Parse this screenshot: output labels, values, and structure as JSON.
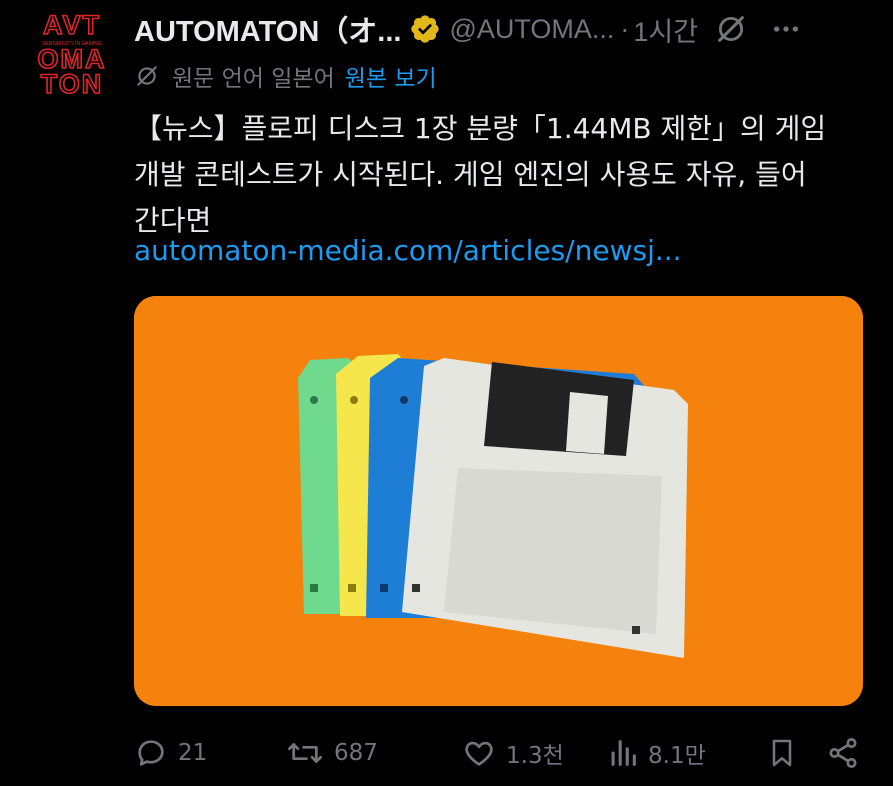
{
  "author": {
    "avatar_text": [
      "AVT",
      "OMA",
      "TON"
    ],
    "avatar_tagline": "VERSATILITY IN GAMING",
    "display_name": "AUTOMATON（オ...",
    "handle": "@AUTOMA...",
    "separator": "·",
    "time": "1시간"
  },
  "translation": {
    "label": "원문 언어 일본어",
    "link": "원본 보기"
  },
  "post": {
    "lines": [
      "【뉴스】플로피 디스크 1장 분량「1.44MB 제한」의 게임",
      "개발 콘테스트가 시작된다. 게임 엔진의 사용도 자유, 들어",
      "간다면"
    ],
    "link": "automaton-media.com/articles/newsj..."
  },
  "actions": {
    "replies": "21",
    "reposts": "687",
    "likes": "1.3천",
    "views": "8.1만"
  },
  "icons": {
    "verified": "verified-badge-icon",
    "translate": "grok-icon",
    "more": "more-icon",
    "reply": "reply-icon",
    "repost": "repost-icon",
    "like": "like-icon",
    "views": "views-icon",
    "bookmark": "bookmark-icon",
    "share": "share-icon"
  },
  "colors": {
    "background": "#000000",
    "text": "#e7e9ea",
    "muted": "#71767b",
    "link": "#1d9bf0",
    "verified": "#e2b719",
    "avatar_red": "#e0242b",
    "media_background": "#f4820c"
  }
}
